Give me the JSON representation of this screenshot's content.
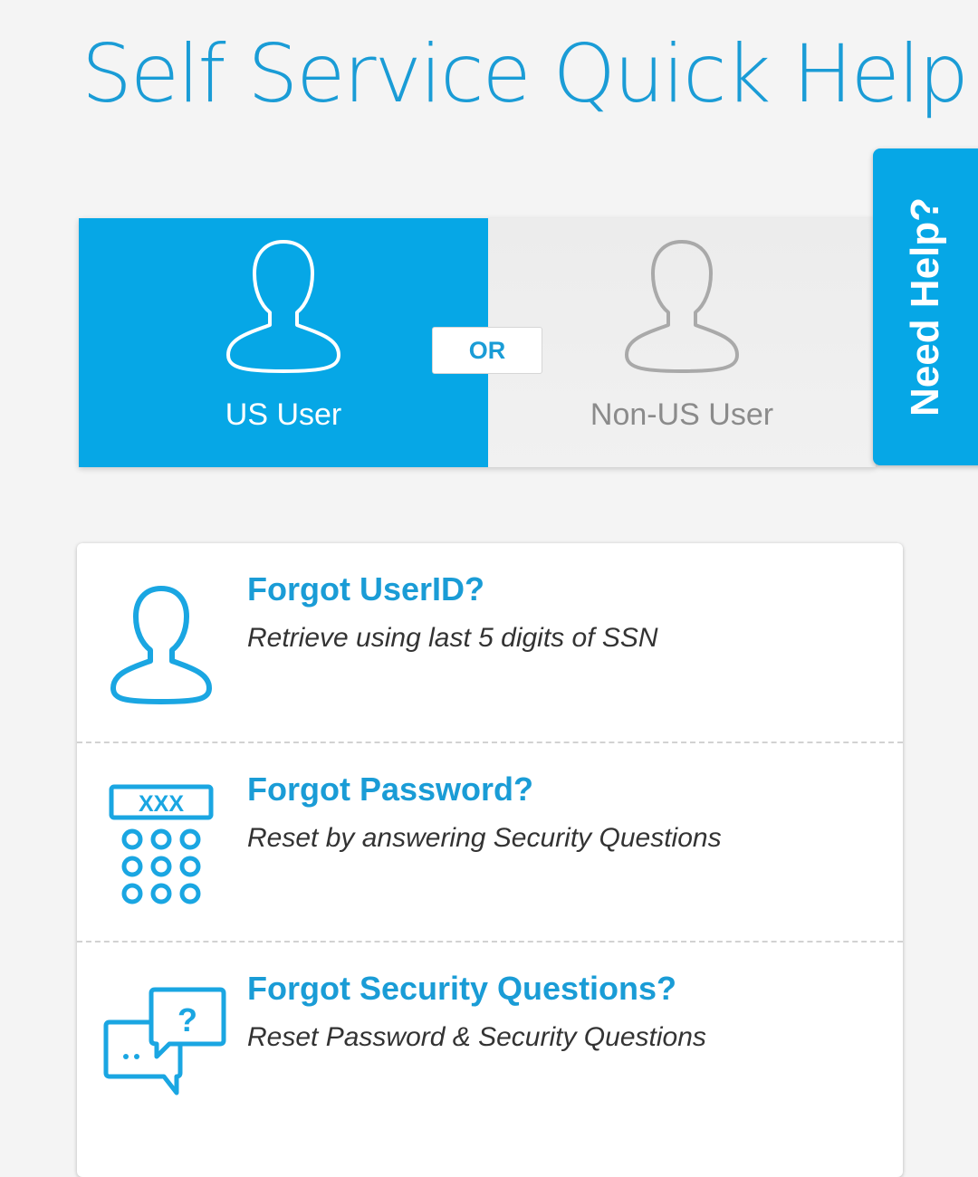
{
  "header": {
    "title": "Self Service Quick Help"
  },
  "user_toggle": {
    "options": [
      {
        "label": "US User",
        "icon": "user-silhouette-icon",
        "selected": true
      },
      {
        "label": "Non-US User",
        "icon": "user-silhouette-icon",
        "selected": false
      }
    ],
    "separator_label": "OR"
  },
  "side_tab": {
    "label": "Need Help?"
  },
  "help_items": [
    {
      "title": "Forgot UserID?",
      "description": "Retrieve using last 5 digits of SSN",
      "icon": "user-icon"
    },
    {
      "title": "Forgot Password?",
      "description": "Reset by answering Security Questions",
      "icon": "password-keypad-icon",
      "icon_text": "XXX"
    },
    {
      "title": "Forgot Security Questions?",
      "description": "Reset Password & Security Questions",
      "icon": "chat-question-icon",
      "icon_text": "?"
    }
  ],
  "colors": {
    "accent": "#06a7e6",
    "title_blue": "#1a9cd6",
    "background": "#f4f4f4",
    "inactive_text": "#8b8b8b"
  }
}
